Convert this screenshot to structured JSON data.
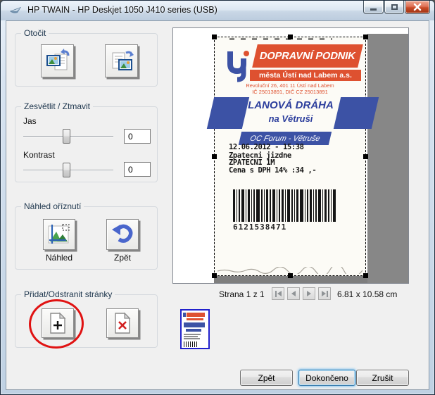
{
  "window": {
    "title": "HP TWAIN - HP Deskjet 1050 J410 series (USB)"
  },
  "left_panel": {
    "rotate_group": {
      "label": "Otočit"
    },
    "brightness_group": {
      "label": "Zesvětlit / Ztmavit",
      "brightness_label": "Jas",
      "brightness_value": "0",
      "contrast_label": "Kontrast",
      "contrast_value": "0"
    },
    "crop_group": {
      "label": "Náhled oříznutí",
      "preview_button_label": "Náhled",
      "undo_button_label": "Zpět"
    },
    "pages_group": {
      "label": "Přidat/Odstranit stránky"
    }
  },
  "preview": {
    "ticket": {
      "company_line1": "DOPRAVNÍ PODNIK",
      "company_line2": "města Ústí nad Labem a.s.",
      "address": "Revoluční 26, 401 11 Ústí nad Labem",
      "registration": "IČ 25013891, DIČ CZ 25013891",
      "service_line1": "LANOVÁ DRÁHA",
      "service_line2": "na Větruši",
      "location": "OC Forum - Větruše",
      "datetime": "12.06.2012 - 15:38",
      "fare_line1": "Zpatecni jizdne",
      "fare_line2": "ZPATECNI 1M",
      "price_line": "Cena s DPH 14% :34 ,-",
      "barcode_number": "6121538471"
    },
    "pager": {
      "status": "Strana 1 z 1",
      "scan_size": "6.81 x 10.58 cm"
    }
  },
  "footer_buttons": {
    "back": "Zpět",
    "done": "Dokončeno",
    "cancel": "Zrušit"
  },
  "icons": {
    "window_icon": "hp-twain-scan-arrow",
    "rotate_left": "rotate-left-icon",
    "rotate_right": "rotate-right-icon",
    "crop_preview": "crop-preview-icon",
    "undo": "undo-arrow-icon",
    "add_page": "add-page-icon",
    "remove_page": "remove-page-icon",
    "nav": [
      "first-page-icon",
      "previous-page-icon",
      "next-page-icon",
      "last-page-icon"
    ],
    "titlebar": [
      "minimize-icon",
      "maximize-icon",
      "close-icon"
    ]
  },
  "colors": {
    "ticket_orange": "#DE5130",
    "ticket_blue": "#3C52A5",
    "annotation": "#E01212",
    "thumb_border": "#2121CC"
  }
}
